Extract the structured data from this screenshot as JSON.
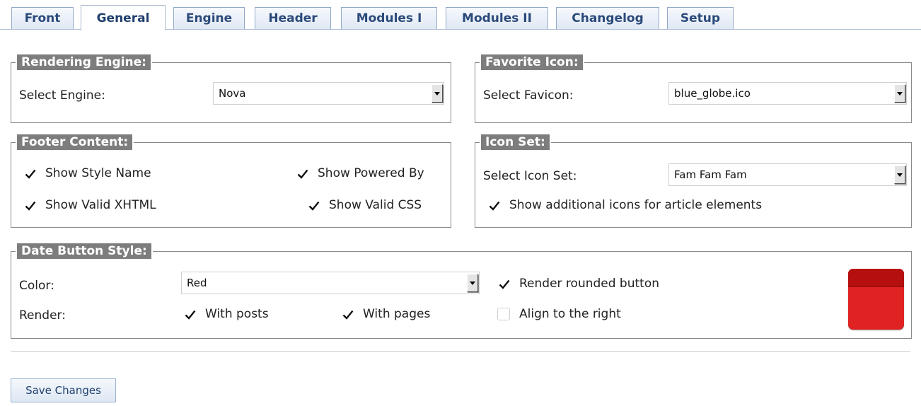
{
  "tabs": [
    {
      "label": "Front",
      "active": false
    },
    {
      "label": "General",
      "active": true
    },
    {
      "label": "Engine",
      "active": false
    },
    {
      "label": "Header",
      "active": false
    },
    {
      "label": "Modules I",
      "active": false
    },
    {
      "label": "Modules II",
      "active": false
    },
    {
      "label": "Changelog",
      "active": false
    },
    {
      "label": "Setup",
      "active": false
    }
  ],
  "rendering_engine": {
    "legend": "Rendering Engine:",
    "select_label": "Select Engine:",
    "select_value": "Nova"
  },
  "favorite_icon": {
    "legend": "Favorite Icon:",
    "select_label": "Select Favicon:",
    "select_value": "blue_globe.ico"
  },
  "footer_content": {
    "legend": "Footer Content:",
    "show_style_name": {
      "label": "Show Style Name",
      "checked": true
    },
    "show_powered_by": {
      "label": "Show Powered By",
      "checked": true
    },
    "show_valid_xhtml": {
      "label": "Show Valid XHTML",
      "checked": true
    },
    "show_valid_css": {
      "label": "Show Valid CSS",
      "checked": true
    }
  },
  "icon_set": {
    "legend": "Icon Set:",
    "select_label": "Select Icon Set:",
    "select_value": "Fam Fam Fam",
    "show_additional": {
      "label": "Show additional icons for article elements",
      "checked": true
    }
  },
  "date_button_style": {
    "legend": "Date Button Style:",
    "color_label": "Color:",
    "color_value": "Red",
    "render_label": "Render:",
    "with_posts": {
      "label": "With posts",
      "checked": true
    },
    "with_pages": {
      "label": "With pages",
      "checked": true
    },
    "render_rounded": {
      "label": "Render rounded button",
      "checked": true
    },
    "align_right": {
      "label": "Align to the right",
      "checked": false
    },
    "preview_colors": {
      "top": "#b50f0f",
      "body": "#e02222"
    }
  },
  "actions": {
    "save_label": "Save Changes"
  },
  "colors": {
    "legend_bg": "#7d7d7d",
    "tab_text": "#2b4a7a",
    "box_border": "#8a8a8a"
  }
}
